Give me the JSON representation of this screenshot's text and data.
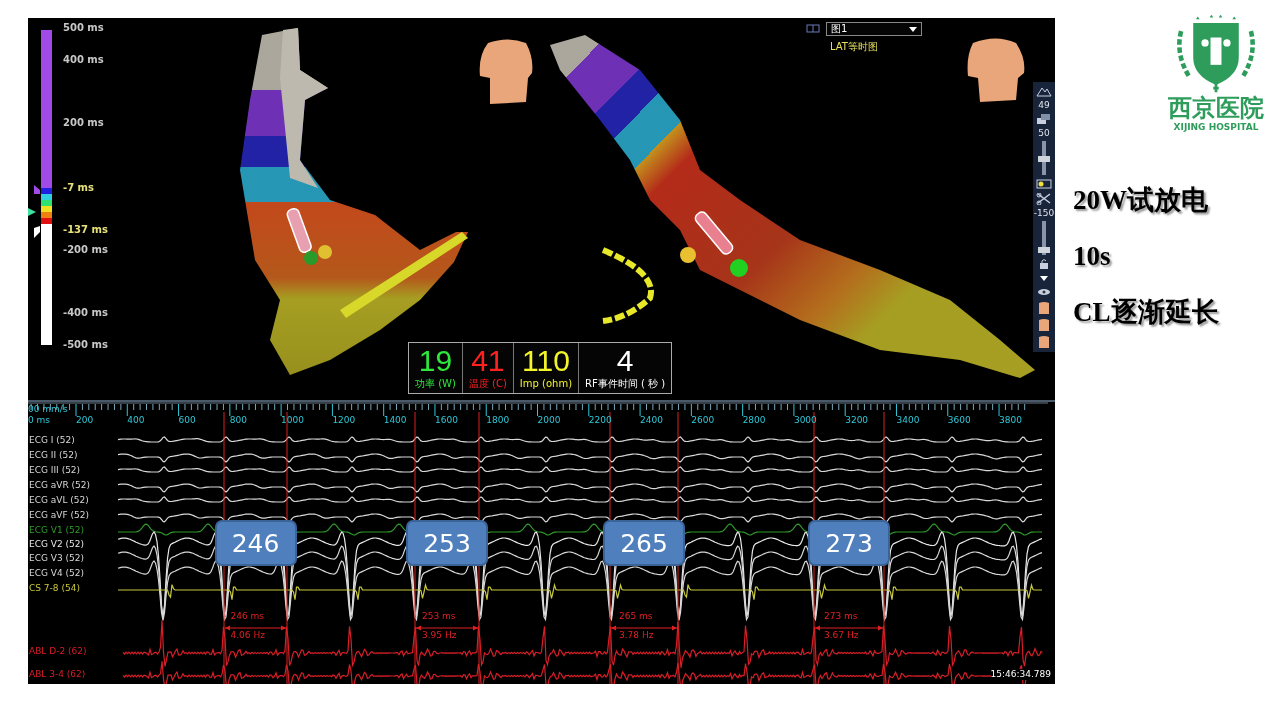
{
  "map_view": {
    "color_scale": {
      "labels": [
        {
          "text": "500 ms",
          "color": "#c8c8c8"
        },
        {
          "text": "400 ms",
          "color": "#c8c8c8"
        },
        {
          "text": "200 ms",
          "color": "#c8c8c8"
        },
        {
          "text": "-7 ms",
          "color": "#e6e07a"
        },
        {
          "text": "-137 ms",
          "color": "#e6e07a"
        },
        {
          "text": "-200 ms",
          "color": "#c8c8c8"
        },
        {
          "text": "-400 ms",
          "color": "#c8c8c8"
        },
        {
          "text": "-500 ms",
          "color": "#c8c8c8"
        }
      ]
    },
    "map_selector": {
      "value": "图1",
      "subtitle": "LAT等时图"
    },
    "toolbar": {
      "point_count": "49",
      "opacity": {
        "text": "50",
        "level": 0.45
      },
      "clip": {
        "text": "-150",
        "level": 0.08
      }
    },
    "rf_readout": [
      {
        "value": "19",
        "label": "功率 (W)",
        "color": "#2ee83c"
      },
      {
        "value": "41",
        "label": "温度 (C)",
        "color": "#ff2020"
      },
      {
        "value": "110",
        "label": "Imp (ohm)",
        "color": "#f4f42a"
      },
      {
        "value": "4",
        "label": "RF事件时间 ( 秒 )",
        "color": "#ffffff"
      }
    ]
  },
  "ecg_view": {
    "speed": "00 mm/s",
    "start": "0 ms",
    "ticks": [
      "200",
      "400",
      "600",
      "800",
      "1000",
      "1200",
      "1400",
      "1600",
      "1800",
      "2000",
      "2200",
      "2400",
      "2600",
      "2800",
      "3000",
      "3200",
      "3400",
      "3600",
      "3800"
    ],
    "channels": [
      {
        "name": "ECG I (52)",
        "kind": "limb",
        "color": "#d8d8d8"
      },
      {
        "name": "ECG II (52)",
        "kind": "limb",
        "color": "#d8d8d8"
      },
      {
        "name": "ECG III (52)",
        "kind": "limb",
        "color": "#d8d8d8"
      },
      {
        "name": "ECG aVR (52)",
        "kind": "limb",
        "color": "#d8d8d8"
      },
      {
        "name": "ECG aVL (52)",
        "kind": "limb",
        "color": "#d8d8d8"
      },
      {
        "name": "ECG aVF (52)",
        "kind": "limb",
        "color": "#d8d8d8"
      },
      {
        "name": "ECG V1 (52)",
        "kind": "bump",
        "color": "#2f9a2a"
      },
      {
        "name": "ECG V2 (52)",
        "kind": "dip",
        "color": "#e8e8e8"
      },
      {
        "name": "ECG V3 (52)",
        "kind": "dip",
        "color": "#d8d8d8"
      },
      {
        "name": "ECG V4 (52)",
        "kind": "dip",
        "color": "#d8d8d8"
      },
      {
        "name": "CS  7-8 (54)",
        "kind": "spike",
        "color": "#c8c83a"
      },
      {
        "name": "ABL  D-2 (62)",
        "kind": "ablation",
        "color": "#d81e28"
      },
      {
        "name": "ABL  3-4 (62)",
        "kind": "ablation",
        "color": "#d81e28"
      }
    ],
    "measurements": [
      {
        "badge": "246",
        "interval": "246 ms",
        "rate": "4.06 Hz"
      },
      {
        "badge": "253",
        "interval": "253 ms",
        "rate": "3.95 Hz"
      },
      {
        "badge": "265",
        "interval": "265 ms",
        "rate": "3.78 Hz"
      },
      {
        "badge": "273",
        "interval": "273 ms",
        "rate": "3.67 Hz"
      }
    ],
    "timestamp": "15:46:34.789"
  },
  "logo": {
    "name": "西京医院",
    "subtitle": "XIJING HOSPITAL"
  },
  "slide": {
    "notes": [
      "20W试放电",
      "10s",
      "CL逐渐延长"
    ]
  }
}
